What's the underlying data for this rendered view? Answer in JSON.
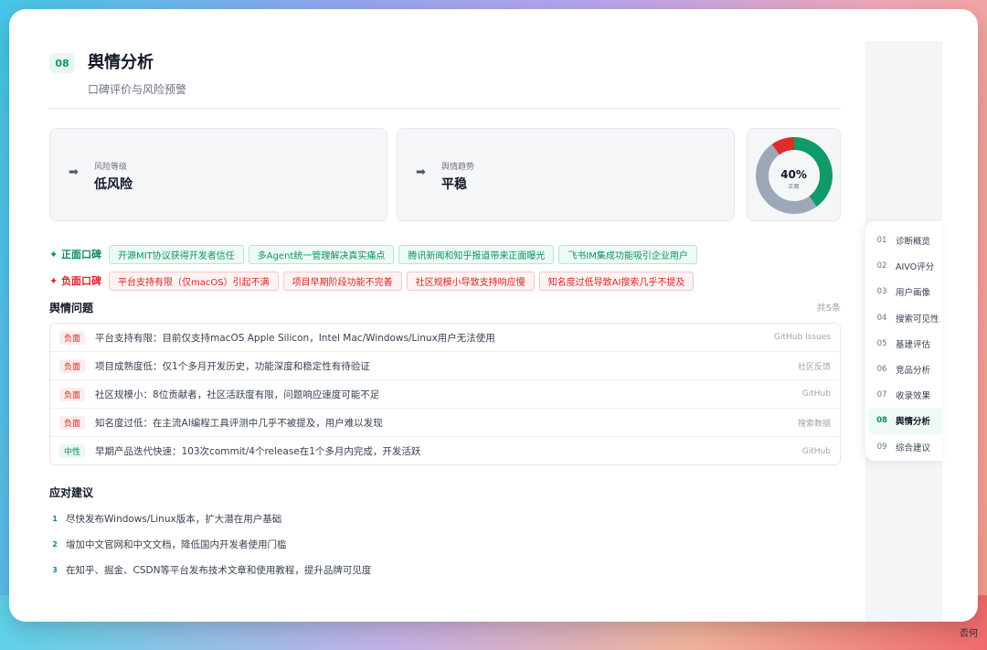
{
  "header": {
    "section_number": "08",
    "title": "舆情分析",
    "subtitle": "口碑评价与风险预警"
  },
  "stats": {
    "risk": {
      "arrow": "➡",
      "label": "风险等级",
      "value": "低风险"
    },
    "trend": {
      "arrow": "➡",
      "label": "舆情趋势",
      "value": "平稳"
    }
  },
  "donut": {
    "percent_label": "40%",
    "sub_label": "正面",
    "segments": [
      {
        "name": "正面",
        "fraction": 0.4,
        "color": "#0f9a67"
      },
      {
        "name": "中性",
        "fraction": 0.5,
        "color": "#9ca8b8"
      },
      {
        "name": "负面",
        "fraction": 0.1,
        "color": "#e02b2b"
      }
    ]
  },
  "positive": {
    "label": "✦ 正面口碑",
    "tags": [
      "开源MIT协议获得开发者信任",
      "多Agent统一管理解决真实痛点",
      "腾讯新闻和知乎报道带来正面曝光",
      "飞书IM集成功能吸引企业用户"
    ]
  },
  "negative": {
    "label": "✦ 负面口碑",
    "tags": [
      "平台支持有限（仅macOS）引起不满",
      "项目早期阶段功能不完善",
      "社区规模小导致支持响应慢",
      "知名度过低导致AI搜索几乎不提及"
    ]
  },
  "issues": {
    "title": "舆情问题",
    "count": "共5条",
    "rows": [
      {
        "sentiment": "负面",
        "type": "neg",
        "text": "平台支持有限：目前仅支持macOS Apple Silicon，Intel Mac/Windows/Linux用户无法使用",
        "source": "GitHub Issues"
      },
      {
        "sentiment": "负面",
        "type": "neg",
        "text": "项目成熟度低：仅1个多月开发历史，功能深度和稳定性有待验证",
        "source": "社区反馈"
      },
      {
        "sentiment": "负面",
        "type": "neg",
        "text": "社区规模小：8位贡献者，社区活跃度有限，问题响应速度可能不足",
        "source": "GitHub"
      },
      {
        "sentiment": "负面",
        "type": "neg",
        "text": "知名度过低：在主流AI编程工具评测中几乎不被提及，用户难以发现",
        "source": "搜索数据"
      },
      {
        "sentiment": "中性",
        "type": "neu",
        "text": "早期产品迭代快速：103次commit/4个release在1个多月内完成，开发活跃",
        "source": "GitHub"
      }
    ]
  },
  "suggestions": {
    "title": "应对建议",
    "items": [
      {
        "num": "1",
        "text": "尽快发布Windows/Linux版本，扩大潜在用户基础"
      },
      {
        "num": "2",
        "text": "增加中文官网和中文文档，降低国内开发者使用门槛"
      },
      {
        "num": "3",
        "text": "在知乎、掘金、CSDN等平台发布技术文章和使用教程，提升品牌可见度"
      }
    ]
  },
  "toc": {
    "items": [
      {
        "num": "01",
        "label": "诊断概览"
      },
      {
        "num": "02",
        "label": "AIVO评分"
      },
      {
        "num": "03",
        "label": "用户画像"
      },
      {
        "num": "04",
        "label": "搜索可见性"
      },
      {
        "num": "05",
        "label": "基建评估"
      },
      {
        "num": "06",
        "label": "竞品分析"
      },
      {
        "num": "07",
        "label": "收录效果"
      },
      {
        "num": "08",
        "label": "舆情分析",
        "active": true
      },
      {
        "num": "09",
        "label": "综合建议"
      }
    ]
  },
  "watermark": "否何"
}
